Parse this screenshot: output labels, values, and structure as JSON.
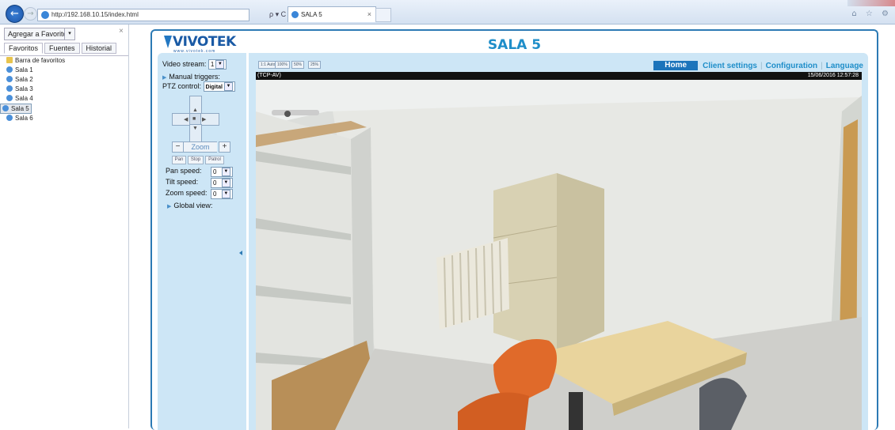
{
  "browser": {
    "url": "http://192.168.10.15/index.html",
    "search_control": "ρ ▾ C",
    "tab_title": "SALA 5",
    "tab_close": "×",
    "tools_icons": "⌂ ☆ ⚙"
  },
  "favorites": {
    "add_button": "Agregar a Favoritos",
    "dropdown": "▾",
    "close": "×",
    "tabs": [
      "Favoritos",
      "Fuentes",
      "Historial"
    ],
    "items": [
      {
        "label": "Barra de favoritos",
        "icon": "folder-icon"
      },
      {
        "label": "Sala 1",
        "icon": "ie-page-icon"
      },
      {
        "label": "Sala 2",
        "icon": "ie-page-icon"
      },
      {
        "label": "Sala 3",
        "icon": "ie-page-icon"
      },
      {
        "label": "Sala 4",
        "icon": "ie-page-icon"
      },
      {
        "label": "Sala 5",
        "icon": "ie-page-icon",
        "selected": true
      },
      {
        "label": "Sala 6",
        "icon": "ie-page-icon"
      }
    ]
  },
  "page": {
    "logo_text": "VIVOTEK",
    "logo_sub": "www.vivotek.com",
    "title": "SALA 5"
  },
  "controls": {
    "video_stream_label": "Video stream:",
    "video_stream_value": "1",
    "manual_triggers": "Manual triggers:",
    "ptz_label": "PTZ control:",
    "ptz_value": "Digital",
    "zoom_label": "Zoom",
    "zoom_minus": "−",
    "zoom_plus": "+",
    "pan_button": "Pan",
    "stop_button": "Stop",
    "patrol_button": "Patrol",
    "pan_speed_label": "Pan speed:",
    "pan_speed_value": "0",
    "tilt_speed_label": "Tilt speed:",
    "tilt_speed_value": "0",
    "zoom_speed_label": "Zoom speed:",
    "zoom_speed_value": "0",
    "global_view": "Global view:"
  },
  "viewer": {
    "ratios": [
      "1:1 Auto",
      "100%",
      "50%",
      "25%"
    ],
    "nav": {
      "home": "Home",
      "client_settings": "Client settings",
      "configuration": "Configuration",
      "language": "Language"
    },
    "stream_label": "(TCP-AV)",
    "timestamp": "15/06/2016 12:57:28"
  },
  "colors": {
    "accent": "#1f8ec9",
    "panel": "#cde6f6",
    "border": "#2c7ab4"
  }
}
